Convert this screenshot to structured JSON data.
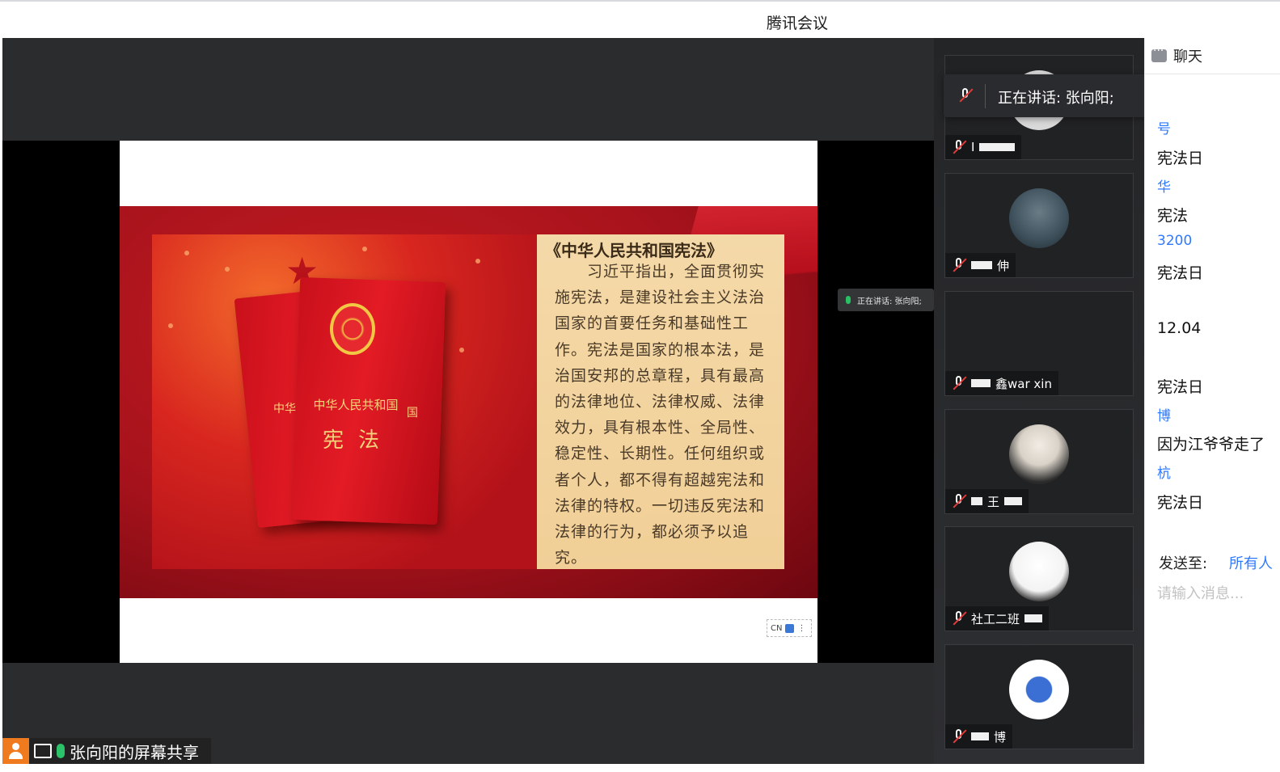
{
  "window": {
    "title": "腾讯会议"
  },
  "share": {
    "label": "张向阳的屏幕共享",
    "mini_speaking": "正在讲话: 张向阳;",
    "cn_widget": "CN"
  },
  "slide": {
    "title": "《中华人民共和国宪法》",
    "body": "习近平指出，全面贯彻实施宪法，是建设社会主义法治国家的首要任务和基础性工作。宪法是国家的根本法，是治国安邦的总章程，具有最高的法律地位、法律权威、法律效力，具有根本性、全局性、稳定性、长期性。任何组织或者个人，都不得有超越宪法和法律的特权。一切违反宪法和法律的行为，都必须予以追究。",
    "book_title": "中华人民共和国",
    "book_big": "宪法",
    "book_side_left": "中华",
    "book_side_right": "国"
  },
  "speaking_popup": {
    "text": "正在讲话: 张向阳;"
  },
  "participants": [
    {
      "name": "I",
      "avatar": "#d8d8d8"
    },
    {
      "name": "伸",
      "avatar": "#3d4f5a"
    },
    {
      "name": "鑫war  xin",
      "avatar": "#212224"
    },
    {
      "name": "王",
      "avatar": "#d9d2c8"
    },
    {
      "name": "社工二班",
      "avatar": "#f3f3f3"
    },
    {
      "name": "博",
      "avatar": "#ffffff"
    }
  ],
  "chat": {
    "header": "聊天",
    "messages": [
      {
        "sender": "号",
        "content": "宪法日"
      },
      {
        "sender": "华",
        "content": "宪法"
      },
      {
        "sender": "3200",
        "content": "宪法日"
      },
      {
        "sender": "",
        "content": "12.04"
      },
      {
        "sender": "",
        "content": "宪法日"
      },
      {
        "sender": "博",
        "content": "因为江爷爷走了"
      },
      {
        "sender": "杭",
        "content": "宪法日"
      }
    ],
    "send_to_label": "发送至:",
    "send_to_target": "所有人",
    "input_placeholder": "请输入消息..."
  },
  "colors": {
    "stage_bg": "#2b2c2e",
    "accent_blue": "#2f79ff",
    "mic_green": "#2bc26a",
    "share_orange": "#f07a1e",
    "slide_red": "#a5121b",
    "slide_gold": "#f1cf97"
  }
}
